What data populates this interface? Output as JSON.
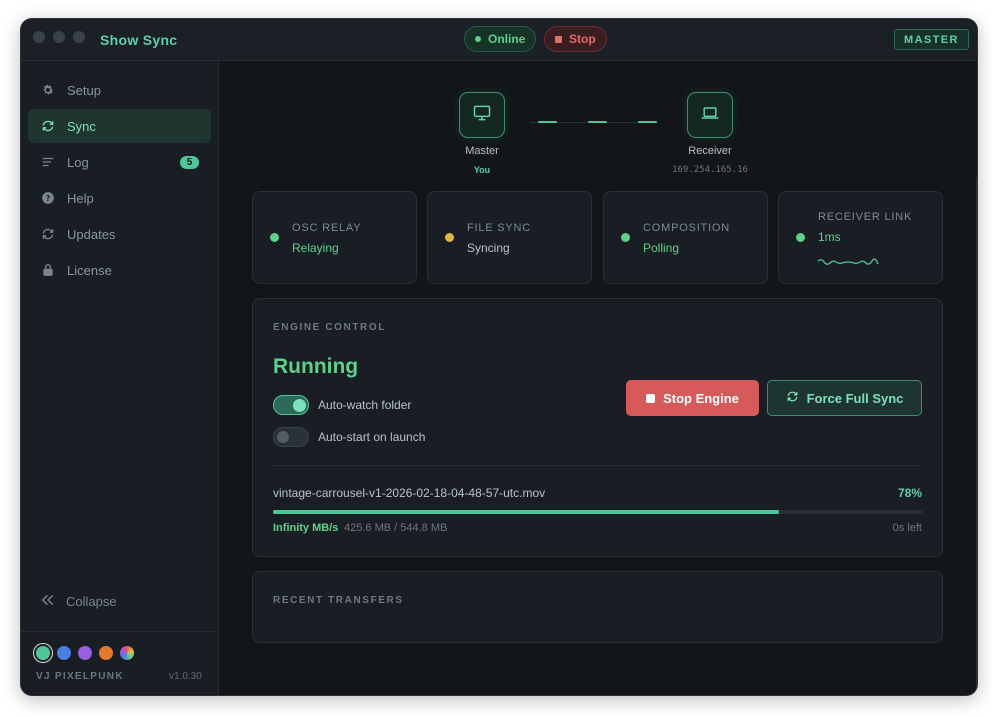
{
  "window": {
    "title": "Show Sync",
    "status_online": "Online",
    "stop_label": "Stop",
    "role_badge": "MASTER"
  },
  "sidebar": {
    "items": [
      {
        "label": "Setup",
        "icon": "gear-icon"
      },
      {
        "label": "Sync",
        "icon": "sync-icon",
        "active": true
      },
      {
        "label": "Log",
        "icon": "log-icon",
        "badge": "5"
      },
      {
        "label": "Help",
        "icon": "help-icon"
      },
      {
        "label": "Updates",
        "icon": "updates-icon"
      },
      {
        "label": "License",
        "icon": "lock-icon"
      }
    ],
    "collapse_label": "Collapse",
    "theme_colors": [
      "#4fc59a",
      "#4a7fe0",
      "#9a5fe0",
      "#e07a2d",
      "#e0c04a"
    ],
    "brand": "VJ PIXELPUNK",
    "version": "v1.0.30"
  },
  "topology": {
    "master": {
      "label": "Master",
      "sub": "You"
    },
    "receiver": {
      "label": "Receiver",
      "sub": "169.254.165.16"
    }
  },
  "status_cards": [
    {
      "title": "OSC RELAY",
      "value": "Relaying",
      "color": "#5fd08a"
    },
    {
      "title": "FILE SYNC",
      "value": "Syncing",
      "color": "#e0b83a"
    },
    {
      "title": "COMPOSITION",
      "value": "Polling",
      "color": "#5fd08a"
    },
    {
      "title": "RECEIVER LINK",
      "value": "1ms",
      "color": "#5fd08a"
    }
  ],
  "engine": {
    "title": "ENGINE CONTROL",
    "state": "Running",
    "auto_watch_label": "Auto-watch folder",
    "auto_watch_on": true,
    "auto_start_label": "Auto-start on launch",
    "auto_start_on": false,
    "stop_button": "Stop Engine",
    "force_button": "Force Full Sync",
    "transfer": {
      "file": "vintage-carrousel-v1-2026-02-18-04-48-57-utc.mov",
      "percent_label": "78%",
      "progress": 0.78,
      "speed": "Infinity MB/s",
      "sizes": "425.6 MB / 544.8 MB",
      "eta": "0s left"
    }
  },
  "recent": {
    "title": "RECENT TRANSFERS"
  }
}
